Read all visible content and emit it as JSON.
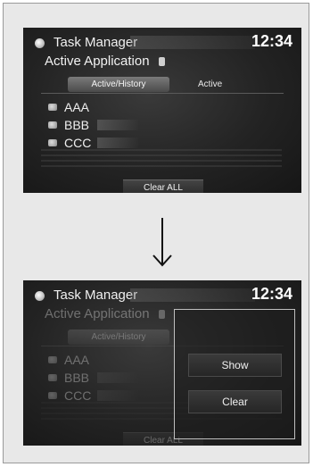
{
  "screen_before": {
    "header": {
      "title": "Task Manager",
      "clock": "12:34"
    },
    "subtitle": "Active Application",
    "tabs": [
      {
        "label": "Active/History",
        "selected": true
      },
      {
        "label": "Active",
        "selected": false
      }
    ],
    "apps": [
      {
        "label": "AAA"
      },
      {
        "label": "BBB"
      },
      {
        "label": "CCC"
      }
    ],
    "clear_all_label": "Clear ALL"
  },
  "screen_after": {
    "header": {
      "title": "Task Manager",
      "clock": "12:34"
    },
    "subtitle": "Active Application",
    "tabs": [
      {
        "label": "Active/History",
        "selected": true
      }
    ],
    "apps": [
      {
        "label": "AAA"
      },
      {
        "label": "BBB"
      },
      {
        "label": "CCC"
      }
    ],
    "clear_all_label": "Clear ALL",
    "popup": {
      "show_label": "Show",
      "clear_label": "Clear"
    }
  },
  "arrow_icon": "arrow-down-icon"
}
